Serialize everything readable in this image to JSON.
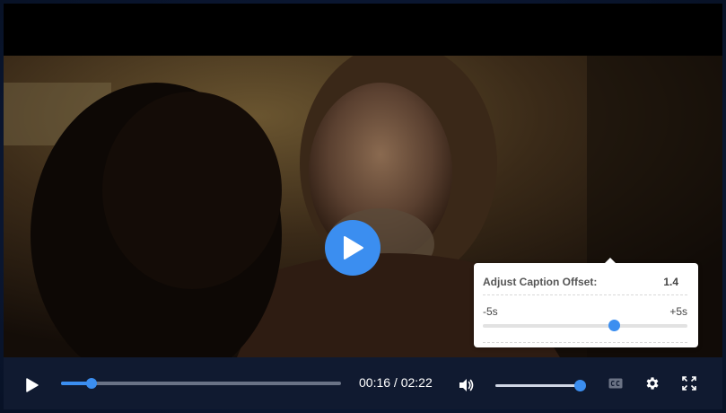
{
  "player": {
    "current_time": "00:16",
    "separator": " / ",
    "duration": "02:22",
    "progress_fraction": 0.11,
    "volume_fraction": 1.0,
    "accent_color": "#3b8ef0"
  },
  "controls": {
    "play_icon": "play-icon",
    "volume_icon": "volume-icon",
    "captions_icon": "closed-captions-icon",
    "settings_icon": "gear-icon",
    "fullscreen_icon": "fullscreen-icon"
  },
  "caption_offset": {
    "title": "Adjust Caption Offset:",
    "value": "1.4",
    "min_label": "-5s",
    "max_label": "+5s",
    "min": -5,
    "max": 5,
    "current": 1.4
  }
}
